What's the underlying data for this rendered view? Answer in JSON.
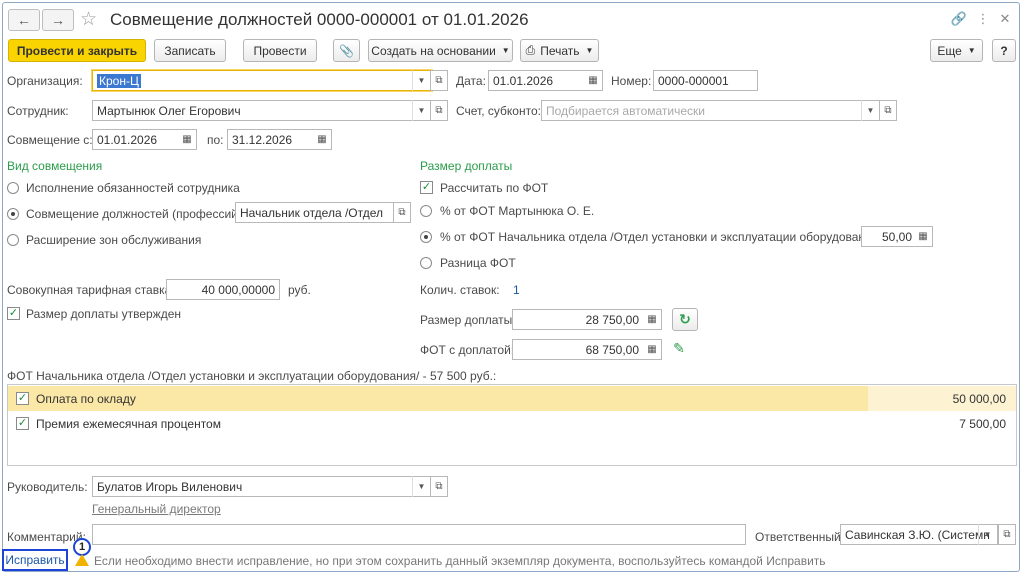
{
  "window": {
    "title": "Совмещение должностей 0000-000001 от 01.01.2026"
  },
  "toolbar": {
    "post_close": "Провести и закрыть",
    "save": "Записать",
    "post": "Провести",
    "create_based": "Создать на основании",
    "print": "Печать",
    "more": "Еще",
    "help": "?"
  },
  "header": {
    "org_label": "Организация:",
    "org_value": "Крон-Ц",
    "date_label": "Дата:",
    "date_value": "01.01.2026",
    "number_label": "Номер:",
    "number_value": "0000-000001",
    "employee_label": "Сотрудник:",
    "employee_value": "Мартынюк Олег Егорович",
    "account_label": "Счет, субконто:",
    "account_placeholder": "Подбирается автоматически",
    "from_label": "Совмещение с:",
    "from_value": "01.01.2026",
    "to_label": "по:",
    "to_value": "31.12.2026"
  },
  "combination": {
    "title": "Вид совмещения",
    "option1": "Исполнение обязанностей сотрудника",
    "option2": "Совмещение должностей (профессий)",
    "option2_position": "Начальник отдела /Отдел",
    "option3": "Расширение зон обслуживания",
    "selected": 2
  },
  "rate": {
    "label": "Совокупная тарифная ставка:",
    "value": "40 000,00000",
    "unit": "руб.",
    "approved_label": "Размер доплаты утвержден",
    "approved": true
  },
  "surcharge": {
    "title": "Размер доплаты",
    "calc_fot_label": "Рассчитать по ФОТ",
    "calc_fot": true,
    "pct_employee": "% от ФОТ Мартынюка О. Е.",
    "pct_head": "% от ФОТ Начальника отдела /Отдел установки и эксплуатации оборудования/",
    "pct_head_value": "50,00",
    "difference": "Разница ФОТ",
    "selected": 2,
    "rates_label": "Колич. ставок:",
    "rates_value": "1",
    "amount_label": "Размер доплаты:",
    "amount_value": "28 750,00",
    "fot_label": "ФОТ с доплатой:",
    "fot_value": "68 750,00"
  },
  "fot_table": {
    "caption": "ФОТ Начальника отдела /Отдел установки и эксплуатации оборудования/ - 57 500 руб.:",
    "rows": [
      {
        "name": "Оплата по окладу",
        "amount": "50 000,00",
        "checked": true
      },
      {
        "name": "Премия ежемесячная процентом",
        "amount": "7 500,00",
        "checked": true
      }
    ]
  },
  "footer": {
    "manager_label": "Руководитель:",
    "manager_value": "Булатов Игорь Виленович",
    "manager_position": "Генеральный директор",
    "comment_label": "Комментарий:",
    "comment_value": "",
    "responsible_label": "Ответственный:",
    "responsible_value": "Савинская З.Ю. (Системн",
    "fix_button": "Исправить",
    "callout_number": "1",
    "hint": "Если необходимо внести исправление, но при этом сохранить данный экземпляр документа, воспользуйтесь командой Исправить"
  },
  "colors": {
    "primary_button": "#f9d400",
    "section_title": "#2a9d4a",
    "selected_row": "#fbe8a7",
    "callout_border": "#1b45d6"
  }
}
